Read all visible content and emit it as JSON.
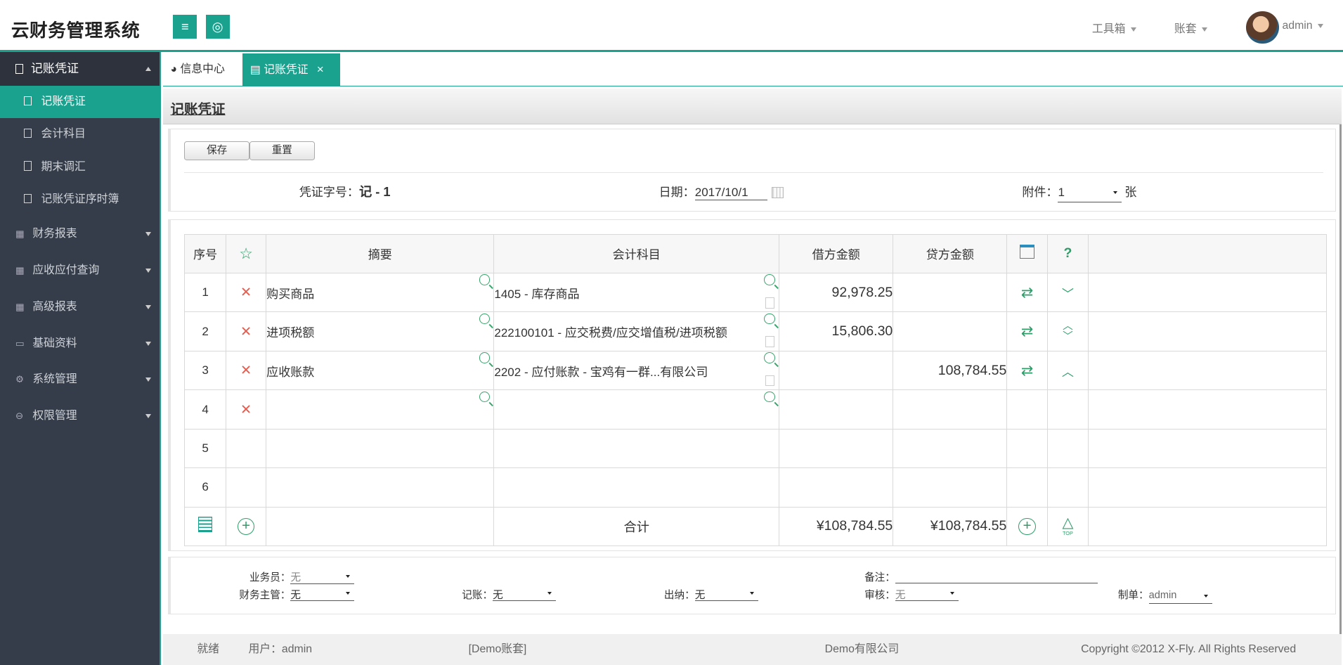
{
  "app": {
    "title": "云财务管理系统"
  },
  "header": {
    "menu_icon": "menu-icon",
    "globe_icon": "globe-icon",
    "toolbox": "工具箱",
    "account_set": "账套",
    "user": "admin"
  },
  "sidebar": {
    "head": "记账凭证",
    "items": [
      {
        "label": "记账凭证",
        "active": true
      },
      {
        "label": "会计科目"
      },
      {
        "label": "期末调汇"
      },
      {
        "label": "记账凭证序时簿"
      }
    ],
    "groups": [
      {
        "label": "财务报表"
      },
      {
        "label": "应收应付查询"
      },
      {
        "label": "高级报表"
      },
      {
        "label": "基础资料"
      },
      {
        "label": "系统管理"
      },
      {
        "label": "权限管理"
      }
    ]
  },
  "tabs": [
    {
      "label": "信息中心"
    },
    {
      "label": "记账凭证"
    }
  ],
  "page": {
    "title": "记账凭证"
  },
  "toolbar": {
    "save": "保存",
    "reset": "重置"
  },
  "voucher": {
    "word_label": "凭证字号：",
    "word_value": "记 - 1",
    "date_label": "日期：",
    "date_value": "2017/10/1",
    "attach_label": "附件：",
    "attach_value": "1",
    "attach_unit": "张"
  },
  "table": {
    "headers": {
      "seq": "序号",
      "summary": "摘要",
      "account": "会计科目",
      "debit": "借方金额",
      "credit": "贷方金额"
    },
    "rows": [
      {
        "seq": "1",
        "summary": "购买商品",
        "account": "1405 - 库存商品",
        "debit": "92,978.25",
        "credit": ""
      },
      {
        "seq": "2",
        "summary": "进项税额",
        "account": "222100101 - 应交税费/应交增值税/进项税额",
        "debit": "15,806.30",
        "credit": ""
      },
      {
        "seq": "3",
        "summary": "应收账款",
        "account": "2202 - 应付账款 - 宝鸡有一群...有限公司",
        "debit": "",
        "credit": "108,784.55"
      },
      {
        "seq": "4",
        "summary": "",
        "account": "",
        "debit": "",
        "credit": ""
      },
      {
        "seq": "5"
      },
      {
        "seq": "6"
      }
    ],
    "total_label": "合计",
    "total_debit": "¥108,784.55",
    "total_credit": "¥108,784.55",
    "top_label": "TOP"
  },
  "footer": {
    "salesman_label": "业务员：",
    "salesman": "无",
    "remark_label": "备注：",
    "remark": "",
    "manager_label": "财务主管：",
    "manager": "无",
    "book_label": "记账：",
    "book": "无",
    "cashier_label": "出纳：",
    "cashier": "无",
    "audit_label": "审核：",
    "audit": "无",
    "maker_label": "制单：",
    "maker": "admin"
  },
  "status": {
    "ready": "就绪",
    "user": "用户：admin",
    "account": "[Demo账套]",
    "company": "Demo有限公司",
    "copyright": "Copyright ©2012 X-Fly. All Rights Reserved"
  },
  "colors": {
    "accent": "#1ba28f",
    "sidebar": "#363d4a",
    "delete": "#e65c4f",
    "icon_green": "#2f9d6a"
  }
}
